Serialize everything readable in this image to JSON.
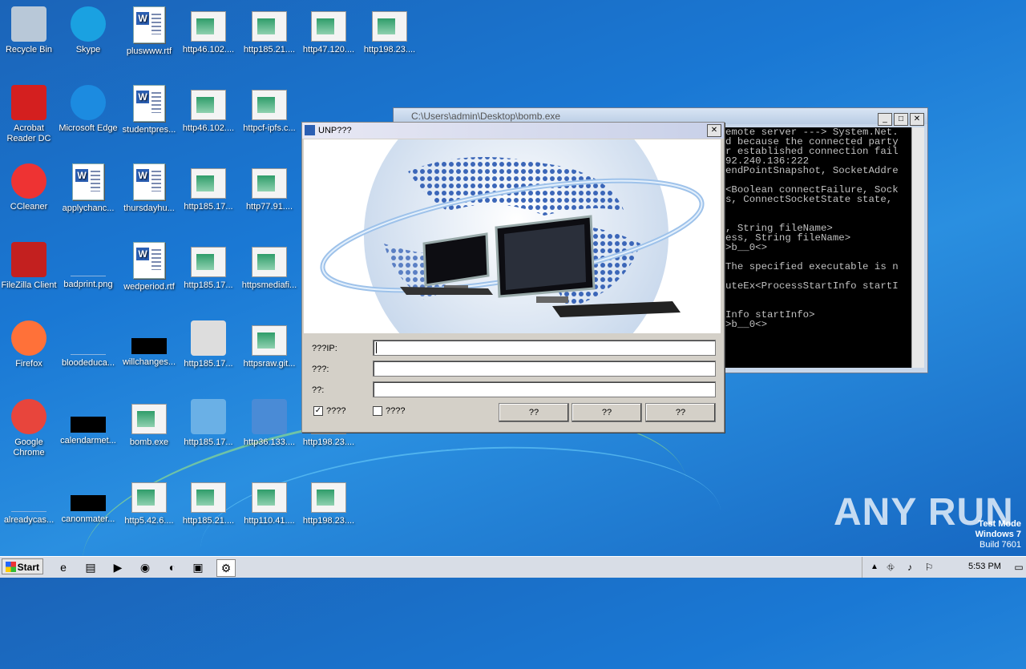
{
  "desktop_icons": [
    {
      "label": "Recycle Bin",
      "icon": "recycle-bin-icon"
    },
    {
      "label": "Skype",
      "icon": "skype-icon"
    },
    {
      "label": "pluswww.rtf",
      "icon": "rtf-doc-icon"
    },
    {
      "label": "http46.102....",
      "icon": "web-file-icon"
    },
    {
      "label": "http185.21....",
      "icon": "web-file-icon"
    },
    {
      "label": "http47.120....",
      "icon": "web-file-icon"
    },
    {
      "label": "http198.23....",
      "icon": "web-file-icon"
    },
    {
      "label": "Acrobat Reader DC",
      "icon": "acrobat-icon"
    },
    {
      "label": "Microsoft Edge",
      "icon": "edge-icon"
    },
    {
      "label": "studentpres...",
      "icon": "rtf-doc-icon"
    },
    {
      "label": "http46.102....",
      "icon": "web-file-icon"
    },
    {
      "label": "httpcf-ipfs.c...",
      "icon": "web-file-icon"
    },
    {
      "label": "CCleaner",
      "icon": "ccleaner-icon"
    },
    {
      "label": "applychanc...",
      "icon": "rtf-doc-icon"
    },
    {
      "label": "thursdayhu...",
      "icon": "rtf-doc-icon"
    },
    {
      "label": "http185.17...",
      "icon": "web-file-icon"
    },
    {
      "label": "http77.91....",
      "icon": "web-file-icon"
    },
    {
      "label": "FileZilla Client",
      "icon": "filezilla-icon"
    },
    {
      "label": "badprint.png",
      "icon": "png-file-icon"
    },
    {
      "label": "wedperiod.rtf",
      "icon": "rtf-doc-icon"
    },
    {
      "label": "http185.17...",
      "icon": "web-file-icon"
    },
    {
      "label": "httpsmediafi...",
      "icon": "web-file-icon"
    },
    {
      "label": "Firefox",
      "icon": "firefox-icon"
    },
    {
      "label": "bloodeduca...",
      "icon": "png-file-icon"
    },
    {
      "label": "willchanges...",
      "icon": "black-file-icon"
    },
    {
      "label": "http185.17...",
      "icon": "first-aid-icon"
    },
    {
      "label": "httpsraw.git...",
      "icon": "web-file-icon"
    },
    {
      "label": "Google Chrome",
      "icon": "chrome-icon"
    },
    {
      "label": "calendarmet...",
      "icon": "black-file-icon"
    },
    {
      "label": "bomb.exe",
      "icon": "web-file-icon"
    },
    {
      "label": "http185.17...",
      "icon": "cart-icon"
    },
    {
      "label": "http36.133....",
      "icon": "monitor-cd-icon"
    },
    {
      "label": "http198.23....",
      "icon": "web-file-icon"
    },
    {
      "label": "alreadycas...",
      "icon": "png-file-icon"
    },
    {
      "label": "canonmater...",
      "icon": "black-file-icon"
    },
    {
      "label": "http5.42.6....",
      "icon": "web-file-icon"
    },
    {
      "label": "http185.21....",
      "icon": "web-file-icon"
    },
    {
      "label": "http110.41....",
      "icon": "web-file-icon"
    },
    {
      "label": "http198.23....",
      "icon": "web-file-icon"
    }
  ],
  "console": {
    "title": "C:\\Users\\admin\\Desktop\\bomb.exe",
    "lines": [
      "emote server ---> System.Net.",
      "d because the connected party",
      "r established connection fail",
      "92.240.136:222",
      "endPointSnapshot, SocketAddre",
      "",
      "<Boolean connectFailure, Sock",
      "s, ConnectSocketState state,",
      "",
      "",
      ", String fileName>",
      "ess, String fileName>",
      ">b__0<>",
      "",
      "The specified executable is n",
      "",
      "uteEx<ProcessStartInfo startI",
      "",
      "",
      "Info startInfo>",
      ">b__0<>"
    ]
  },
  "dialog": {
    "title": "UNP???",
    "ip_label": "???IP:",
    "field2_label": "???:",
    "field3_label": "??:",
    "check1_label": "????",
    "check1_mark": "✓",
    "check2_label": "????",
    "btn1": "??",
    "btn2": "??",
    "btn3": "??"
  },
  "taskbar": {
    "start": "Start",
    "time": "5:53 PM"
  },
  "watermark": "ANY RUN",
  "test_mode": {
    "line1": "Test Mode",
    "line2": "Windows 7",
    "line3": "Build 7601"
  }
}
